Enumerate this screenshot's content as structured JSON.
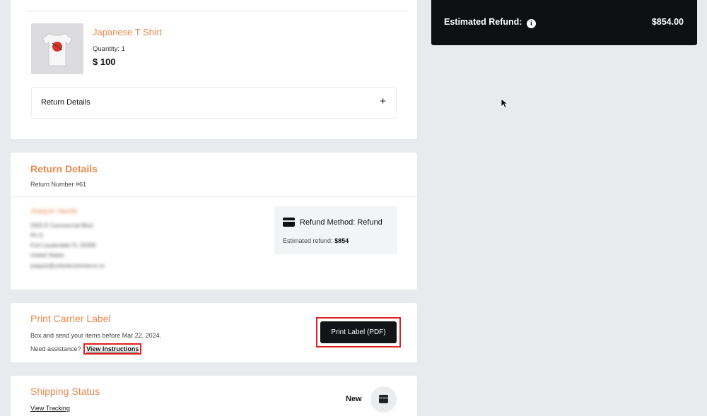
{
  "product": {
    "name": "Japanese T Shirt",
    "quantity": "Quantity: 1",
    "price": "$ 100",
    "return_details_label": "Return Details",
    "expand_symbol": "+",
    "thumb_icon": "tshirt-image"
  },
  "return_details": {
    "title": "Return Details",
    "return_number": "Return Number #61",
    "address": {
      "name": "Joaquin Varela",
      "lines": [
        "2925 E Commercial Blvd",
        "Ph G",
        "Fort Lauderdale FL 33308",
        "United States",
        "joaquin@unlockcommerce.co"
      ]
    },
    "refund_method": "Refund Method: Refund",
    "estimated_refund_label": "Estimated refund:",
    "estimated_refund_value": "$854",
    "card_icon": "credit-card-icon"
  },
  "print_label": {
    "title": "Print Carrier Label",
    "note": "Box and send your items before Mar 22, 2024.",
    "assist_prefix": "Need assistance?",
    "view_instructions": "View Instructions",
    "button_label": "Print Label (PDF)"
  },
  "shipping": {
    "title": "Shipping Status",
    "view_tracking": "View Tracking",
    "status": "New",
    "status_icon": "box-icon"
  },
  "summary": {
    "label": "Estimated Refund:",
    "info_symbol": "i",
    "value": "$854.00"
  },
  "colors": {
    "accent": "#e8894f",
    "highlight": "#e02020",
    "dark": "#0d0f13",
    "background": "#e9eaed"
  }
}
